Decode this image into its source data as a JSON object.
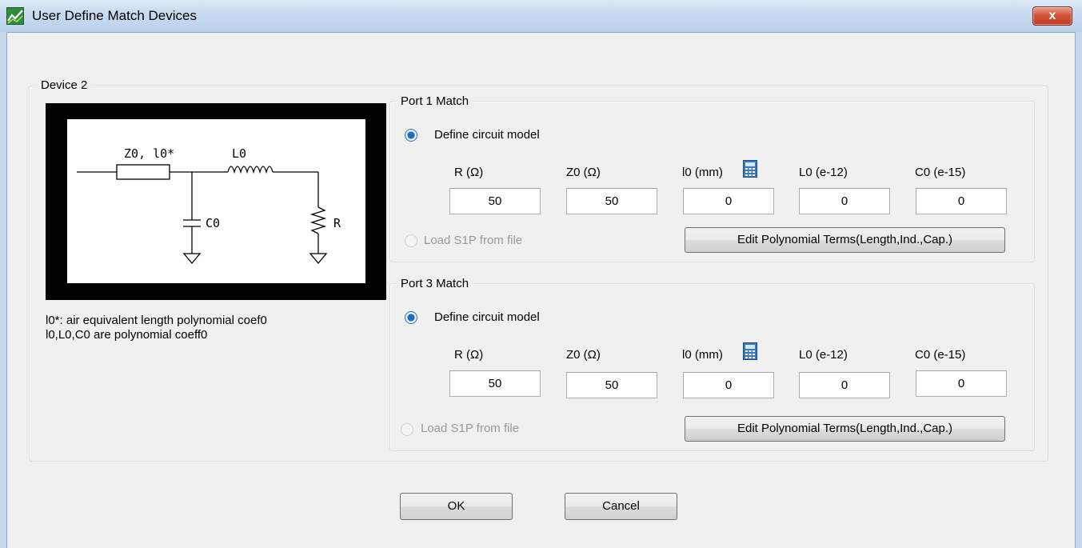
{
  "window": {
    "title": "User Define Match Devices",
    "close_label": "x"
  },
  "device": {
    "group_label": "Device 2",
    "diagram": {
      "label_z0": "Z0, l0*",
      "label_l0": "L0",
      "label_c0": "C0",
      "label_r": "R"
    },
    "notes": [
      "l0*: air equivalent length polynomial coef0",
      "l0,L0,C0 are polynomial coeff0"
    ]
  },
  "ports": [
    {
      "title": "Port 1 Match",
      "define_label": "Define circuit model",
      "define_selected": true,
      "load_label": "Load S1P from file",
      "load_enabled": false,
      "columns": [
        {
          "label": "R (Ω)",
          "value": "50"
        },
        {
          "label": "Z0 (Ω)",
          "value": "50"
        },
        {
          "label": "l0 (mm)",
          "value": "0"
        },
        {
          "label": "L0 (e-12)",
          "value": "0"
        },
        {
          "label": "C0 (e-15)",
          "value": "0"
        }
      ],
      "poly_button": "Edit Polynomial Terms(Length,Ind.,Cap.)"
    },
    {
      "title": "Port 3 Match",
      "define_label": "Define circuit model",
      "define_selected": true,
      "load_label": "Load S1P from file",
      "load_enabled": false,
      "columns": [
        {
          "label": "R (Ω)",
          "value": "50"
        },
        {
          "label": "Z0 (Ω)",
          "value": "50"
        },
        {
          "label": "l0 (mm)",
          "value": "0"
        },
        {
          "label": "L0 (e-12)",
          "value": "0"
        },
        {
          "label": "C0 (e-15)",
          "value": "0"
        }
      ],
      "poly_button": "Edit Polynomial Terms(Length,Ind.,Cap.)"
    }
  ],
  "footer": {
    "ok_label": "OK",
    "cancel_label": "Cancel"
  },
  "colors": {
    "titlebar": "#c6d9ef",
    "close": "#c23b20",
    "radio_selected": "#1f6cbf"
  },
  "icons": [
    "app-icon",
    "close-icon",
    "calculator-icon"
  ]
}
